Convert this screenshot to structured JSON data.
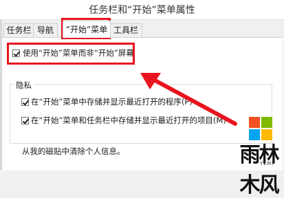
{
  "window": {
    "title": "任务栏和“开始”菜单属性"
  },
  "tabs": [
    {
      "label": "任务栏"
    },
    {
      "label": "导航"
    },
    {
      "label": "“开始”菜单"
    },
    {
      "label": "工具栏"
    }
  ],
  "main": {
    "use_start_checkbox": {
      "label": "使用“开始”菜单而非“开始”屏幕",
      "checked": true
    }
  },
  "privacy": {
    "title": "隐私",
    "items": [
      {
        "label": "在“开始”菜单中存储并显示最近打开的程序(P)",
        "checked": true
      },
      {
        "label": "在“开始”菜单和任务栏中存储并显示最近打开的项目(M)",
        "checked": true
      }
    ]
  },
  "footer": {
    "text": "从我的磁贴中清除个人信息。"
  },
  "watermark": {
    "brand": "雨林木风",
    "sub": "YLMF",
    "windows_colors": [
      "#f25022",
      "#7fba00",
      "#00a4ef",
      "#ffb900"
    ]
  },
  "colors": {
    "highlight": "#e8141e"
  }
}
